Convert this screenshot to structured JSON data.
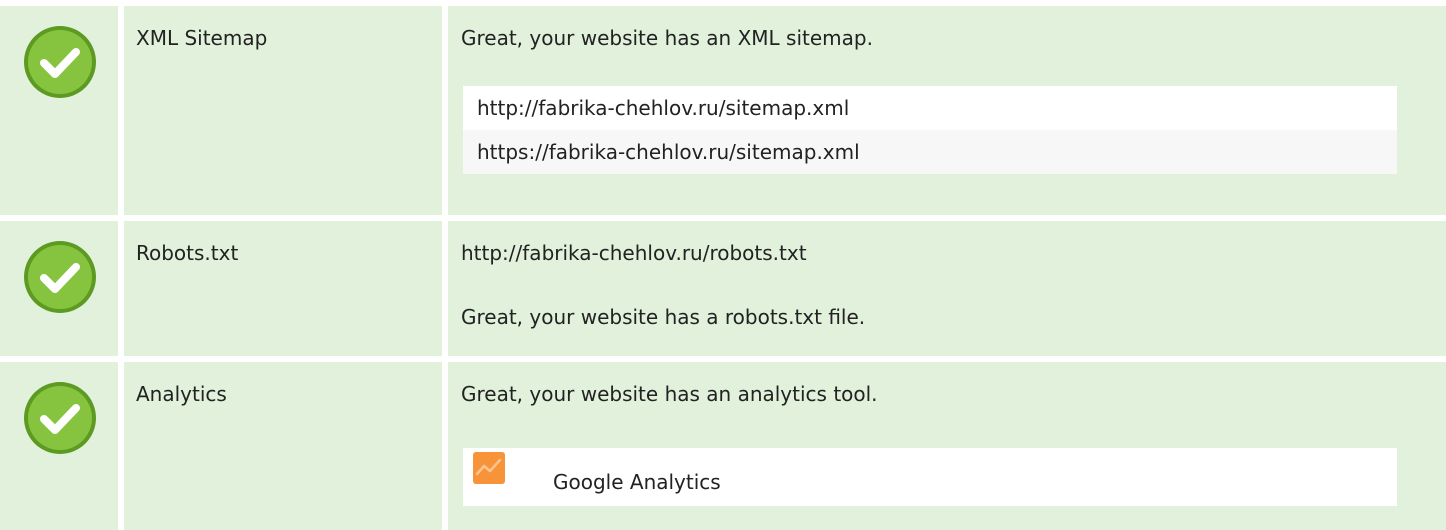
{
  "colors": {
    "row_background": "#e1f1dc",
    "check_green": "#7cbb3a",
    "analytics_orange": "#f7943a"
  },
  "rows": [
    {
      "label": "XML Sitemap",
      "status_icon": "check-circle-icon",
      "message": "Great, your website has an XML sitemap.",
      "sitemaps": [
        "http://fabrika-chehlov.ru/sitemap.xml",
        "https://fabrika-chehlov.ru/sitemap.xml"
      ]
    },
    {
      "label": "Robots.txt",
      "status_icon": "check-circle-icon",
      "url": "http://fabrika-chehlov.ru/robots.txt",
      "message": "Great, your website has a robots.txt file."
    },
    {
      "label": "Analytics",
      "status_icon": "check-circle-icon",
      "message": "Great, your website has an analytics tool.",
      "tool": {
        "name": "Google Analytics",
        "icon": "google-analytics-icon"
      }
    }
  ]
}
